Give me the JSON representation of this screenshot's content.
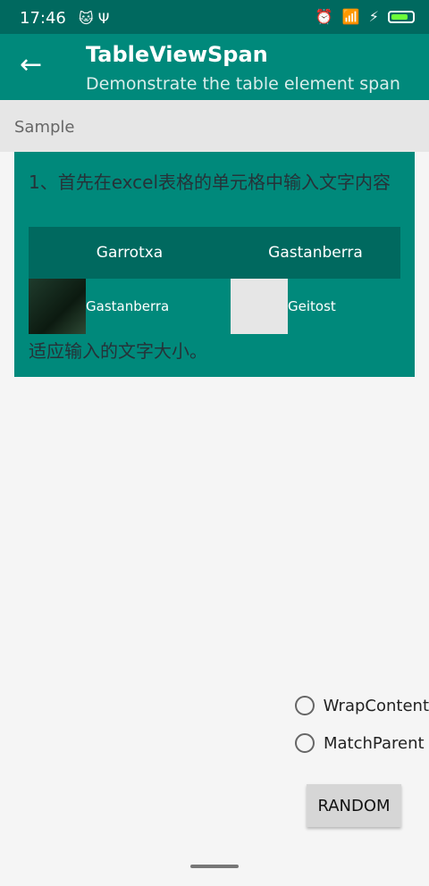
{
  "status": {
    "time": "17:46",
    "icons_left": [
      "cat-icon",
      "usb-icon"
    ],
    "icons_right": [
      "alarm-icon",
      "wifi-icon",
      "lte-icon",
      "bolt-icon",
      "battery-icon"
    ]
  },
  "appbar": {
    "title": "TableViewSpan",
    "subtitle": "Demonstrate the table element span"
  },
  "section": {
    "label": "Sample"
  },
  "card": {
    "text_top": "1、首先在excel表格的单元格中输入文字内容",
    "table": {
      "headers": [
        "Garrotxa",
        "Gastanberra"
      ],
      "cells": [
        "Gastanberra",
        "Geitost"
      ]
    },
    "text_bottom": "适应输入的文字大小。"
  },
  "radios": [
    {
      "label": "WrapContent"
    },
    {
      "label": "MatchParent"
    }
  ],
  "button": {
    "label": "RANDOM"
  }
}
